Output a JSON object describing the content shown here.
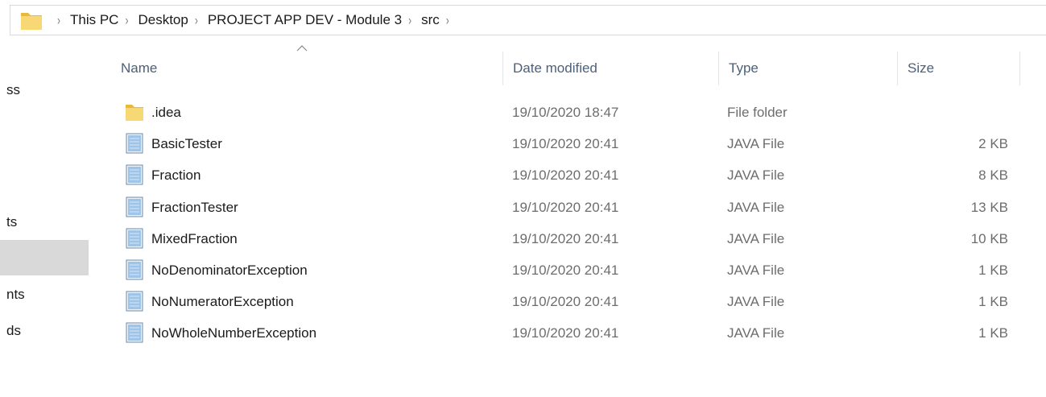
{
  "address_bar": {
    "crumbs": [
      "This PC",
      "Desktop",
      "PROJECT APP DEV - Module 3",
      "src"
    ]
  },
  "nav_pane": {
    "items": [
      {
        "label": "ss",
        "selected": false
      },
      {
        "label": "ts",
        "selected": false
      },
      {
        "label": "",
        "selected": true
      },
      {
        "label": "nts",
        "selected": false
      },
      {
        "label": "ds",
        "selected": false
      }
    ]
  },
  "columns": {
    "name": "Name",
    "date": "Date modified",
    "type": "Type",
    "size": "Size"
  },
  "files": [
    {
      "name": ".idea",
      "date": "19/10/2020 18:47",
      "type": "File folder",
      "size": "",
      "icon": "folder-icon"
    },
    {
      "name": "BasicTester",
      "date": "19/10/2020 20:41",
      "type": "JAVA File",
      "size": "2 KB",
      "icon": "java-file-icon"
    },
    {
      "name": "Fraction",
      "date": "19/10/2020 20:41",
      "type": "JAVA File",
      "size": "8 KB",
      "icon": "java-file-icon"
    },
    {
      "name": "FractionTester",
      "date": "19/10/2020 20:41",
      "type": "JAVA File",
      "size": "13 KB",
      "icon": "java-file-icon"
    },
    {
      "name": "MixedFraction",
      "date": "19/10/2020 20:41",
      "type": "JAVA File",
      "size": "10 KB",
      "icon": "java-file-icon"
    },
    {
      "name": "NoDenominatorException",
      "date": "19/10/2020 20:41",
      "type": "JAVA File",
      "size": "1 KB",
      "icon": "java-file-icon"
    },
    {
      "name": "NoNumeratorException",
      "date": "19/10/2020 20:41",
      "type": "JAVA File",
      "size": "1 KB",
      "icon": "java-file-icon"
    },
    {
      "name": "NoWholeNumberException",
      "date": "19/10/2020 20:41",
      "type": "JAVA File",
      "size": "1 KB",
      "icon": "java-file-icon"
    }
  ],
  "colors": {
    "folder": "#f8d775",
    "folder_dark": "#e8b93c",
    "selection": "#d9d9d9",
    "header_text": "#4c607a"
  }
}
